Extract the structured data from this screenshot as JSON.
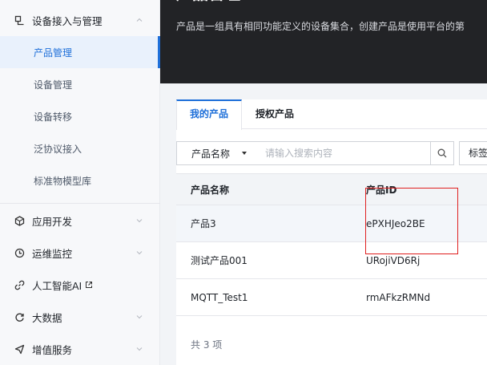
{
  "sidebar": {
    "group_device": {
      "label": "设备接入与管理",
      "icon": "device-access-icon"
    },
    "sub_items": [
      {
        "label": "产品管理",
        "active": true
      },
      {
        "label": "设备管理",
        "active": false
      },
      {
        "label": "设备转移",
        "active": false
      },
      {
        "label": "泛协议接入",
        "active": false
      },
      {
        "label": "标准物模型库",
        "active": false
      }
    ],
    "groups": [
      {
        "label": "应用开发",
        "icon": "cube-icon"
      },
      {
        "label": "运维监控",
        "icon": "clock-icon"
      },
      {
        "label": "人工智能AI",
        "icon": "link-icon",
        "external": true
      },
      {
        "label": "大数据",
        "icon": "cycle-icon"
      },
      {
        "label": "增值服务",
        "icon": "send-icon"
      }
    ]
  },
  "banner": {
    "title": "产品管理",
    "description": "产品是一组具有相同功能定义的设备集合，创建产品是使用平台的第"
  },
  "tabs": [
    {
      "label": "我的产品",
      "active": true
    },
    {
      "label": "授权产品",
      "active": false
    }
  ],
  "filter": {
    "select_value": "产品名称",
    "search_placeholder": "请输入搜索内容",
    "tag_label": "标签"
  },
  "table": {
    "columns": [
      "产品名称",
      "产品ID"
    ],
    "rows": [
      {
        "name": "产品3",
        "id": "ePXHJeo2BE"
      },
      {
        "name": "测试产品001",
        "id": "URojiVD6Rj"
      },
      {
        "name": "MQTT_Test1",
        "id": "rmAFkzRMNd"
      }
    ],
    "total_text": "共 3 项"
  },
  "colors": {
    "accent": "#1e6fd9",
    "banner_bg": "#222326",
    "highlight": "#e02020"
  }
}
